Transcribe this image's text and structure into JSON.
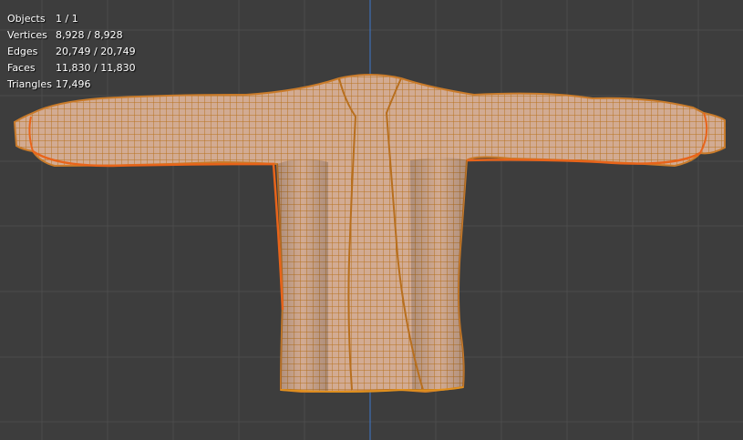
{
  "stats": {
    "objects": {
      "label": "Objects",
      "value": "1 / 1"
    },
    "vertices": {
      "label": "Vertices",
      "value": "8,928 / 8,928"
    },
    "edges": {
      "label": "Edges",
      "value": "20,749 / 20,749"
    },
    "faces": {
      "label": "Faces",
      "value": "11,830 / 11,830"
    },
    "triangles": {
      "label": "Triangles",
      "value": "17,496"
    }
  },
  "colors": {
    "viewport_bg": "#3d3d3d",
    "grid": "#4a4a4a",
    "axis_z": "#3e6fb5",
    "mesh_fill": "#c9a38a",
    "wire": "#c97b2a",
    "selection_outline": "#e8641a"
  },
  "mesh": {
    "name": "jacket-mesh",
    "mode": "edit-wireframe"
  }
}
